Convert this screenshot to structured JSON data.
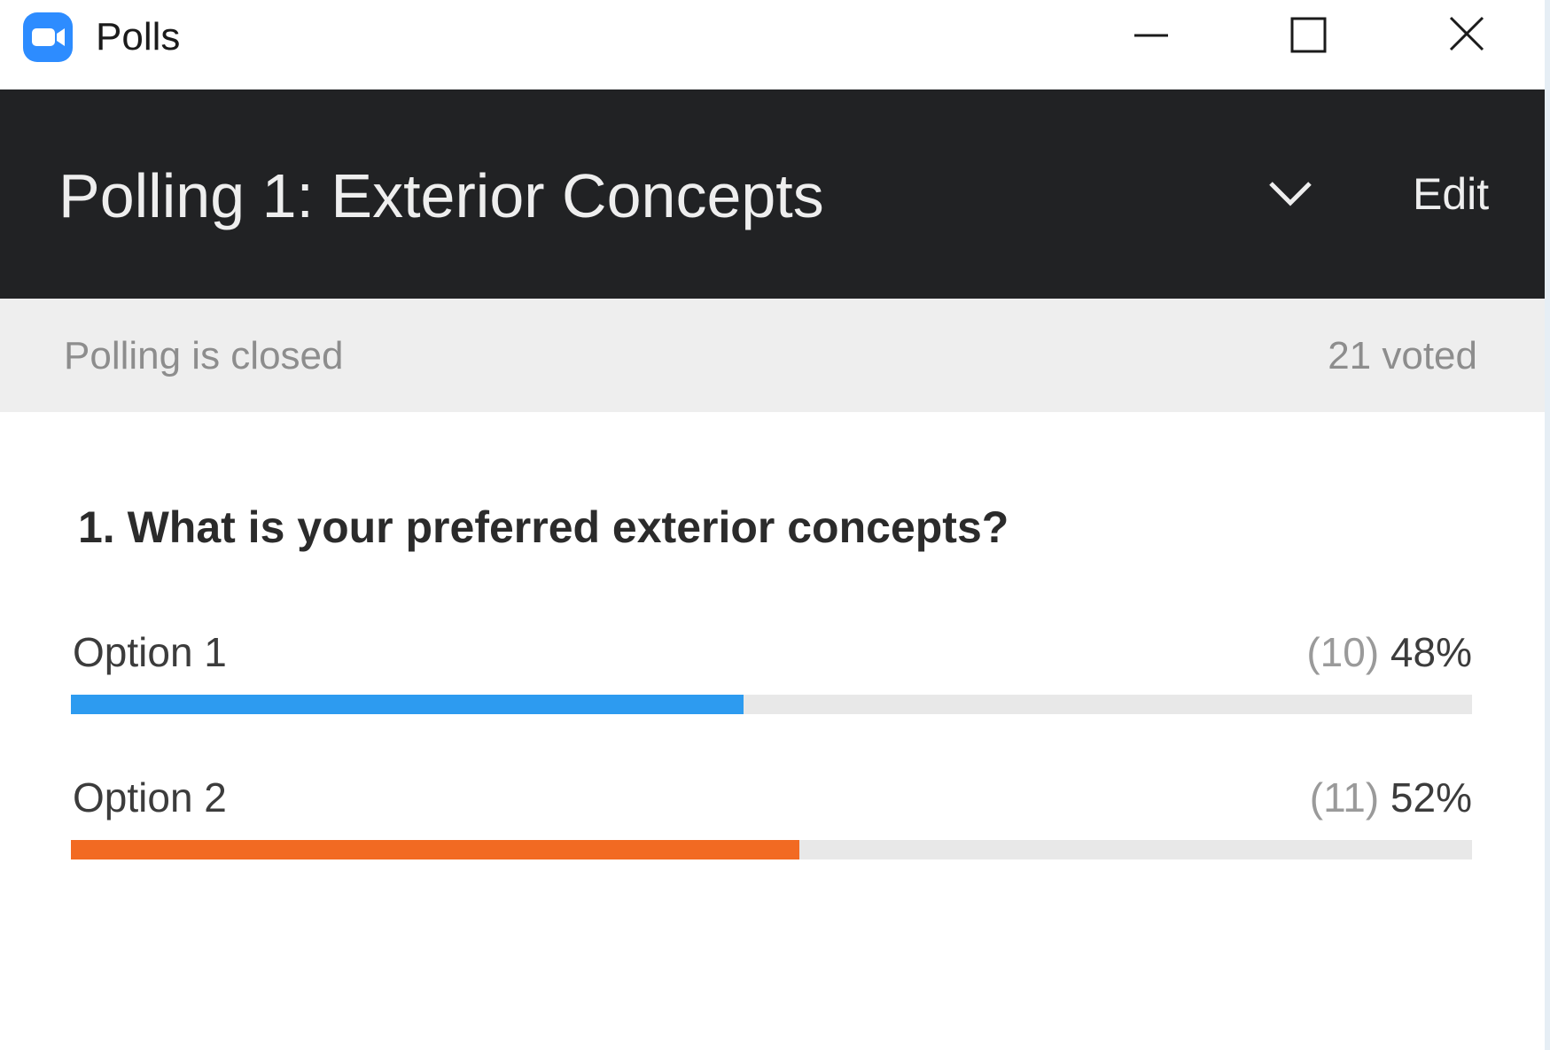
{
  "window": {
    "title": "Polls",
    "app_icon": "zoom-camera-icon",
    "controls": [
      "minimize-icon",
      "maximize-icon",
      "close-icon"
    ]
  },
  "header": {
    "title": "Polling 1: Exterior Concepts",
    "dropdown_icon": "chevron-down-icon",
    "edit_label": "Edit"
  },
  "status": {
    "state_text": "Polling is closed",
    "voted_text": "21 voted"
  },
  "question": {
    "text": "1. What is your preferred exterior concepts?",
    "options": [
      {
        "label": "Option 1",
        "count_text": "(10)",
        "percent_text": "48%",
        "fraction": 0.48,
        "color": "#2d9bf0"
      },
      {
        "label": "Option 2",
        "count_text": "(11)",
        "percent_text": "52%",
        "fraction": 0.52,
        "color": "#f26a22"
      }
    ]
  },
  "colors": {
    "header_bg": "#212224",
    "status_bg": "#eeeeee",
    "bar_track": "#e8e8e8",
    "zoom_blue": "#2d8cff"
  }
}
